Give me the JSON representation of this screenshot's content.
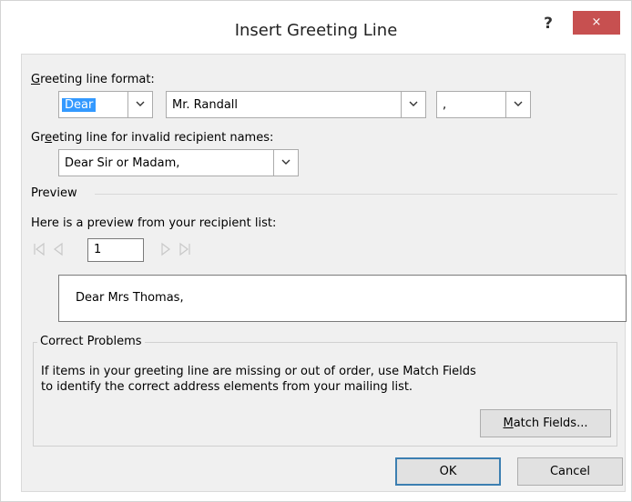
{
  "dialog": {
    "title": "Insert Greeting Line",
    "help_label": "?",
    "close_label": "×"
  },
  "greeting_format": {
    "label_accel": "G",
    "label_rest": "reeting line format:",
    "salutation": "Dear",
    "name_format": "Mr. Randall",
    "punctuation": ","
  },
  "invalid_names": {
    "label_pre": "Gr",
    "label_accel": "e",
    "label_rest": "eting line for invalid recipient names:",
    "value": "Dear Sir or Madam,"
  },
  "preview": {
    "section_label": "Preview",
    "description": "Here is a preview from your recipient list:",
    "record_number": "1",
    "preview_text": "Dear Mrs Thomas,"
  },
  "correct_problems": {
    "legend": "Correct Problems",
    "line1": "If items in your greeting line are missing or out of order, use Match Fields",
    "line2": "to identify the correct address elements from your mailing list.",
    "match_accel": "M",
    "match_rest": "atch Fields..."
  },
  "buttons": {
    "ok": "OK",
    "cancel": "Cancel"
  },
  "colors": {
    "close_button": "#c75050",
    "selection": "#3399ff",
    "default_button_border": "#3c7fb1"
  }
}
